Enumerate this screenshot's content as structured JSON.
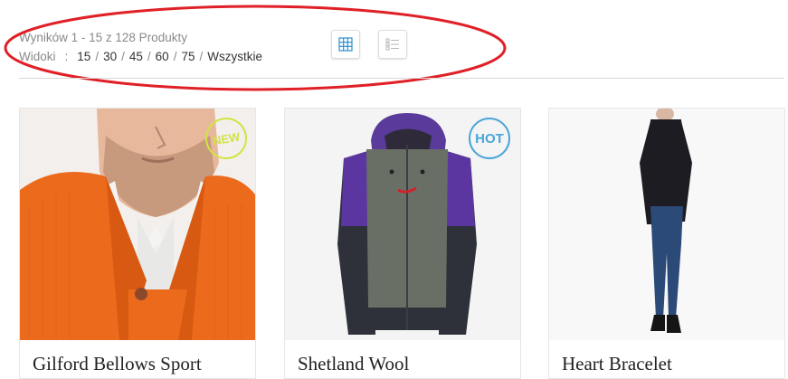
{
  "toolbar": {
    "results_text": "Wyników 1 - 15 z 128 Produkty",
    "views_label": "Widoki",
    "views_colon": ":",
    "view_options": [
      "15",
      "30",
      "45",
      "60",
      "75",
      "Wszystkie"
    ],
    "separator": "/",
    "grid_icon": "grid-icon",
    "list_icon": "list-icon",
    "grid_active": true
  },
  "annotation": {
    "color": "#e02027"
  },
  "products": [
    {
      "title": "Gilford Bellows Sport",
      "badge": "NEW",
      "badge_color": "#d2e343"
    },
    {
      "title": "Shetland Wool",
      "badge": "HOT",
      "badge_color": "#4aa6d8"
    },
    {
      "title": "Heart Bracelet",
      "badge": "",
      "badge_color": ""
    }
  ]
}
